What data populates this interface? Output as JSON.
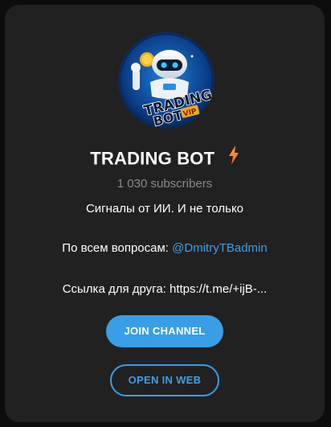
{
  "channel": {
    "avatar_alt": "TRADING BOT VIP",
    "avatar_text": {
      "line1": "TRADING",
      "line2": "BOT",
      "badge": "VIP"
    },
    "title": "TRADING BOT",
    "title_icon": "lightning-bolt-icon",
    "subscribers": "1 030 subscribers",
    "description": {
      "line1": "Сигналы от ИИ. И не только",
      "line2_prefix": "По всем вопросам: ",
      "line2_link": "@DmitryTBadmin",
      "line3": "Ссылка для друга: https://t.me/+ijB-..."
    }
  },
  "actions": {
    "join_label": "JOIN CHANNEL",
    "open_web_label": "OPEN IN WEB"
  },
  "colors": {
    "card_bg": "#212121",
    "accent": "#3a9ee6",
    "link": "#3f9fe3",
    "muted": "#8a8a8a"
  }
}
